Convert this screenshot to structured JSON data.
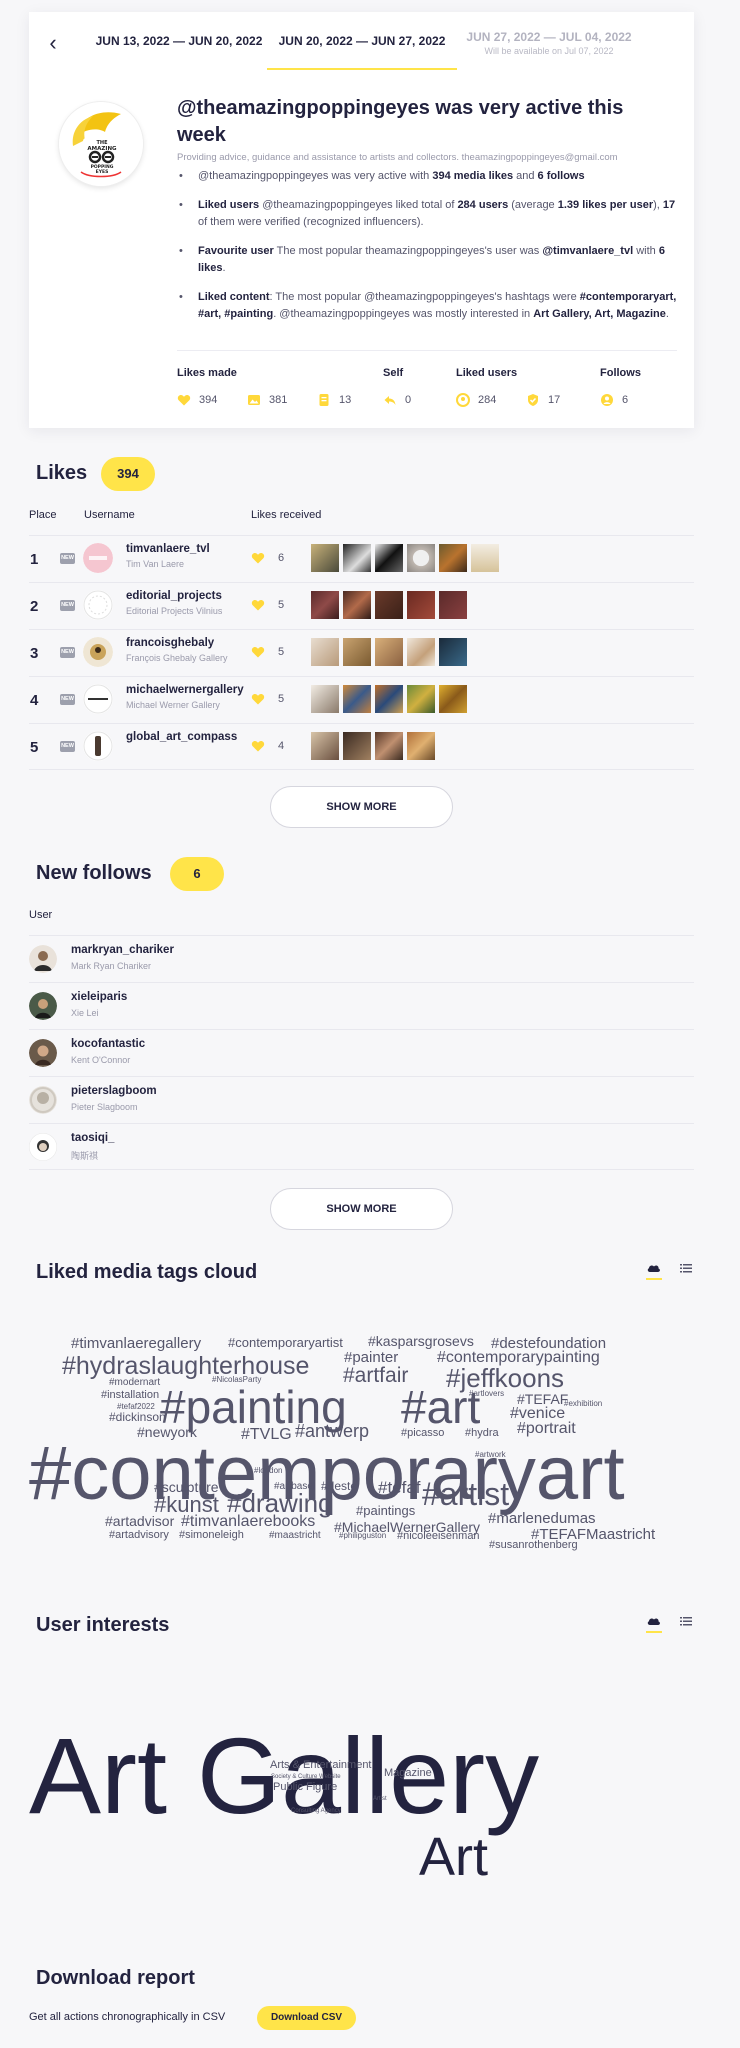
{
  "tabs": [
    {
      "label": "JUN 13, 2022 — JUN 20, 2022"
    },
    {
      "label": "JUN 20, 2022 — JUN 27, 2022"
    },
    {
      "label": "JUN 27, 2022 — JUL 04, 2022",
      "note": "Will be available on Jul 07, 2022"
    }
  ],
  "summary": {
    "avatar_text": [
      "THE",
      "AMAZING",
      "POPPING",
      "EYES"
    ],
    "headline": "@theamazingpoppingeyes was very active this week",
    "tagline": "Providing advice, guidance and assistance to artists and collectors. theamazingpoppingeyes@gmail.com",
    "b1": {
      "p1": "@theamazingpoppingeyes was very active with ",
      "likes": "394 media likes",
      "p2": " and ",
      "follows": "6 follows"
    },
    "b2": {
      "label": "Liked users",
      "p1": " @theamazingpoppingeyes liked total of ",
      "users": "284 users",
      "p2": " (average ",
      "avg": "1.39 likes per user",
      "p3": "), ",
      "verified": "17",
      "p4": " of them were verified (recognized influencers)."
    },
    "b3": {
      "label": "Favourite user",
      "p1": " The most popular theamazingpoppingeyes's user was ",
      "user": "@timvanlaere_tvl",
      "p2": " with ",
      "likes": "6 likes",
      "p3": "."
    },
    "b4": {
      "label": "Liked content",
      "p1": ": The most popular @theamazingpoppingeyes's hashtags were ",
      "tags": "#contemporaryart, #art, #painting",
      "p2": ". @theamazingpoppingeyes was mostly interested in ",
      "interests": "Art Gallery, Art, Magazine",
      "p3": "."
    },
    "stats": {
      "likes_made": "Likes made",
      "self": "Self",
      "liked_users": "Liked users",
      "follows": "Follows",
      "v_likes": "394",
      "v_media": "381",
      "v_other": "13",
      "v_self": "0",
      "v_users": "284",
      "v_verified": "17",
      "v_follows": "6"
    }
  },
  "likes": {
    "title": "Likes",
    "count": "394",
    "col_place": "Place",
    "col_username": "Username",
    "col_received": "Likes received",
    "new_label": "NEW",
    "rows": [
      {
        "place": "1",
        "user": "timvanlaere_tvl",
        "name": "Tim Van Laere",
        "likes": "6"
      },
      {
        "place": "2",
        "user": "editorial_projects",
        "name": "Editorial Projects Vilnius",
        "likes": "5"
      },
      {
        "place": "3",
        "user": "francoisghebaly",
        "name": "François Ghebaly Gallery",
        "likes": "5"
      },
      {
        "place": "4",
        "user": "michaelwernergallery",
        "name": "Michael Werner Gallery",
        "likes": "5"
      },
      {
        "place": "5",
        "user": "global_art_compass",
        "name": "",
        "likes": "4"
      }
    ],
    "show_more": "SHOW MORE"
  },
  "follows": {
    "title": "New follows",
    "count": "6",
    "col_user": "User",
    "rows": [
      {
        "user": "markryan_chariker",
        "name": "Mark Ryan Chariker"
      },
      {
        "user": "xieleiparis",
        "name": "Xie Lei"
      },
      {
        "user": "kocofantastic",
        "name": "Kent O'Connor"
      },
      {
        "user": "pieterslagboom",
        "name": "Pieter Slagboom"
      },
      {
        "user": "taosiqi_",
        "name": "陶斯祺"
      }
    ],
    "show_more": "SHOW MORE"
  },
  "tags_cloud": {
    "title": "Liked media tags cloud",
    "words": [
      "#timvanlaeregallery",
      "#contemporaryartist",
      "#kasparsgrosevs",
      "#destefoundation",
      "#hydraslaughterhouse",
      "#painter",
      "#contemporarypainting",
      "#modernart",
      "#NicolasParty",
      "#artfair",
      "#jeffkoons",
      "#installation",
      "#tefaf2022",
      "#painting",
      "#art",
      "#TEFAF",
      "#exhibition",
      "#dickinson",
      "#venice",
      "#newyork",
      "#TVLG",
      "#antwerp",
      "#picasso",
      "#hydra",
      "#portrait",
      "#contemporaryart",
      "#sculpture",
      "#artbasel",
      "#deste",
      "#tefaf",
      "#artist",
      "#kunst",
      "#drawing",
      "#paintings",
      "#artadvisor",
      "#timvanlaerebooks",
      "#MichaelWernerGallery",
      "#marlenedumas",
      "#artadvisory",
      "#simoneleigh",
      "#maastricht",
      "#philipguston",
      "#nicoleeisenman",
      "#TEFAFMaastricht",
      "#susanrothenberg",
      "#artlovers",
      "#artwork",
      "#london"
    ]
  },
  "interests": {
    "title": "User interests",
    "words": [
      "Art Gallery",
      "Art",
      "Arts & Entertainment",
      "Magazine",
      "Public Figure",
      "Society & Culture Website",
      "Consulting Agency",
      "Artist"
    ]
  },
  "download": {
    "title": "Download report",
    "text": "Get all actions chronographically in CSV",
    "button": "Download CSV"
  },
  "colors": {
    "accent": "#ffe449",
    "text": "#23233f",
    "muted": "#9a9aab"
  }
}
